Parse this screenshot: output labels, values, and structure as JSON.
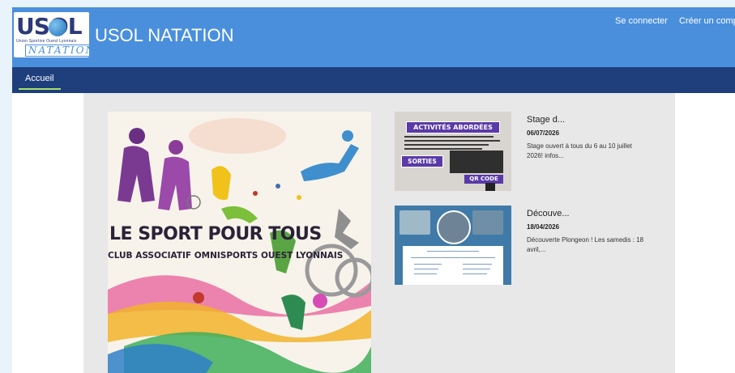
{
  "site": {
    "logo_text": "USOL",
    "logo_subtitle": "Union Sportive Ouest Lyonnais",
    "logo_natation": "NATATION",
    "title": "USOL NATATION"
  },
  "header": {
    "login_label": "Se connecter",
    "register_label": "Créer un compte"
  },
  "nav": {
    "items": [
      {
        "label": "Accueil",
        "active": true
      }
    ]
  },
  "hero": {
    "title": "LE SPORT POUR TOUS",
    "subtitle": "CLUB ASSOCIATIF OMNISPORTS OUEST LYONNAIS"
  },
  "news": [
    {
      "title": "Stage d...",
      "date": "06/07/2026",
      "excerpt": "Stage ouvert à tous du 6 au 10 juillet 2026! infos...",
      "thumb_heading": "ACTIVITÉS ABORDÉES",
      "thumb_sorties": "SORTIES",
      "thumb_qr": "QR CODE"
    },
    {
      "title": "Découve...",
      "date": "18/04/2026",
      "excerpt": "Découverte Plongeon ! Les samedis : 18 avril,..."
    }
  ],
  "colors": {
    "topbar": "#4a8fdc",
    "navbar": "#1e3f7c",
    "nav_active_underline": "#a9e06a",
    "content_bg": "#e8e8e8"
  }
}
